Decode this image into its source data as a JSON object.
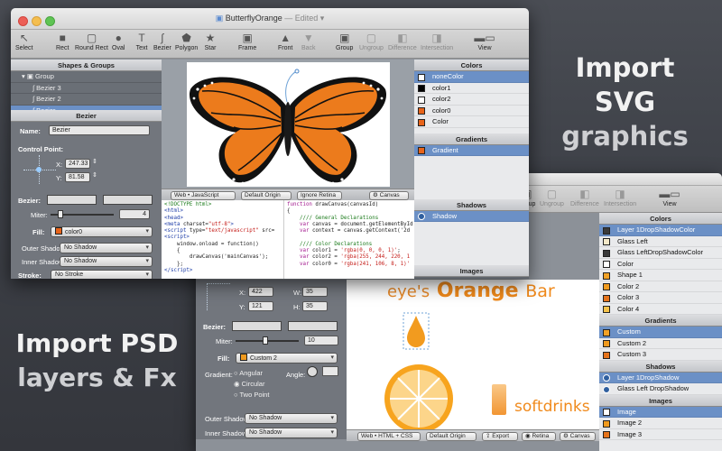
{
  "promo": {
    "svg_line1": "Import SVG",
    "svg_line2": "graphics",
    "psd_line1": "Import PSD",
    "psd_line2": "layers & Fx"
  },
  "front": {
    "title": "ButterflyOrange",
    "title_status": "— Edited ▾",
    "toolbar": [
      {
        "label": "Select",
        "icon": "arrow-cursor-icon"
      },
      {
        "label": "Rect",
        "icon": "rectangle-icon"
      },
      {
        "label": "Round Rect",
        "icon": "rounded-rectangle-icon"
      },
      {
        "label": "Oval",
        "icon": "oval-icon"
      },
      {
        "label": "Text",
        "icon": "text-icon"
      },
      {
        "label": "Bezier",
        "icon": "bezier-icon"
      },
      {
        "label": "Polygon",
        "icon": "polygon-icon"
      },
      {
        "label": "Star",
        "icon": "star-icon"
      },
      {
        "label": "Frame",
        "icon": "frame-icon"
      },
      {
        "label": "Front",
        "icon": "bring-front-icon"
      },
      {
        "label": "Back",
        "icon": "send-back-icon"
      },
      {
        "label": "Group",
        "icon": "group-icon"
      },
      {
        "label": "Ungroup",
        "icon": "ungroup-icon"
      },
      {
        "label": "Difference",
        "icon": "difference-icon"
      },
      {
        "label": "Intersection",
        "icon": "intersection-icon"
      },
      {
        "label": "View",
        "icon": "view-icon"
      }
    ],
    "shapes_header": "Shapes & Groups",
    "shapes": [
      {
        "label": "Group",
        "selected": false
      },
      {
        "label": "Bezier 3",
        "selected": false
      },
      {
        "label": "Bezier 2",
        "selected": false
      },
      {
        "label": "Bezier",
        "selected": true
      }
    ],
    "inspector": {
      "header": "Bezier",
      "name_label": "Name:",
      "name_value": "Bezier",
      "control_point_label": "Control Point:",
      "x_label": "X:",
      "x_value": "247.33",
      "y_label": "Y:",
      "y_value": "81.58",
      "bezier_label": "Bezier:",
      "miter_label": "Miter:",
      "miter_value": "4",
      "fill_label": "Fill:",
      "fill_value": "color0",
      "outer_shadow_label": "Outer Shadow",
      "outer_shadow_value": "No Shadow",
      "inner_shadow_label": "Inner Shadow",
      "inner_shadow_value": "No Shadow",
      "stroke_label": "Stroke:",
      "stroke_value": "No Stroke"
    },
    "code_bar": {
      "lang": "Web • JavaScript",
      "origin": "Default Origin",
      "retina": "Ignore Retina",
      "canvas": "Canvas"
    },
    "colors_header": "Colors",
    "colors": [
      {
        "label": "noneColor",
        "color": "#ffffff",
        "selected": true
      },
      {
        "label": "color1",
        "color": "#000000",
        "selected": false
      },
      {
        "label": "color2",
        "color": "#ffffff",
        "selected": false
      },
      {
        "label": "color0",
        "color": "#e8641a",
        "selected": false
      },
      {
        "label": "Color",
        "color": "#e8641a",
        "selected": false
      }
    ],
    "gradients_header": "Gradients",
    "gradients": [
      {
        "label": "Gradient",
        "selected": true
      }
    ],
    "shadows_header": "Shadows",
    "shadows": [
      {
        "label": "Shadow",
        "selected": true
      }
    ],
    "images_header": "Images"
  },
  "back": {
    "toolbar": [
      {
        "label": "Group",
        "icon": "group-icon"
      },
      {
        "label": "Ungroup",
        "icon": "ungroup-icon"
      },
      {
        "label": "Difference",
        "icon": "difference-icon"
      },
      {
        "label": "Intersection",
        "icon": "intersection-icon"
      },
      {
        "label": "View",
        "icon": "view-icon"
      }
    ],
    "inspector": {
      "x_label": "X:",
      "x_value": "422",
      "w_label": "W:",
      "w_value": "35",
      "y_label": "Y:",
      "y_value": "121",
      "h_label": "H:",
      "h_value": "35",
      "bezier_label": "Bezier:",
      "miter_label": "Miter:",
      "miter_value": "10",
      "fill_label": "Fill:",
      "fill_value": "Custom 2",
      "gradient_label": "Gradient:",
      "gradient_options": [
        "Angular",
        "Circular",
        "Two Point"
      ],
      "angle_label": "Angle:",
      "outer_shadow_label": "Outer Shadow",
      "outer_shadow_value": "No Shadow",
      "inner_shadow_label": "Inner Shadow",
      "inner_shadow_value": "No Shadow"
    },
    "canvas_text": {
      "eyes": "eye's",
      "orange": "Orange",
      "bar": "Bar",
      "softdrinks": "softdrinks"
    },
    "code_bar": {
      "lang": "Web • HTML + CSS",
      "origin": "Default Origin",
      "export": "Export",
      "retina": "Retina",
      "canvas": "Canvas"
    },
    "colors_header": "Colors",
    "colors": [
      {
        "label": "Layer 1DropShadowColor",
        "color": "#3a3a3a",
        "selected": true
      },
      {
        "label": "Glass Left",
        "color": "#f5e9c8",
        "selected": false
      },
      {
        "label": "Glass LeftDropShadowColor",
        "color": "#3a3a3a",
        "selected": false
      },
      {
        "label": "Color",
        "color": "#ffffff",
        "selected": false
      },
      {
        "label": "Shape 1",
        "color": "#f2a227",
        "selected": false
      },
      {
        "label": "Color 2",
        "color": "#f09a1e",
        "selected": false
      },
      {
        "label": "Color 3",
        "color": "#e5731b",
        "selected": false
      },
      {
        "label": "Color 4",
        "color": "#f5c24a",
        "selected": false
      }
    ],
    "gradients_header": "Gradients",
    "gradients": [
      {
        "label": "Custom",
        "color": "#f2a227",
        "selected": true
      },
      {
        "label": "Custom 2",
        "color": "#f09a1e",
        "selected": false
      },
      {
        "label": "Custom 3",
        "color": "#e5731b",
        "selected": false
      }
    ],
    "shadows_header": "Shadows",
    "shadows": [
      {
        "label": "Layer 1DropShadow",
        "selected": true
      },
      {
        "label": "Glass Left DropShadow",
        "selected": false
      }
    ],
    "images_header": "Images",
    "images": [
      {
        "label": "Image",
        "color": "#ffffff",
        "selected": true
      },
      {
        "label": "Image 2",
        "color": "#f09a1e",
        "selected": false
      },
      {
        "label": "Image 3",
        "color": "#e5731b",
        "selected": false
      }
    ]
  }
}
